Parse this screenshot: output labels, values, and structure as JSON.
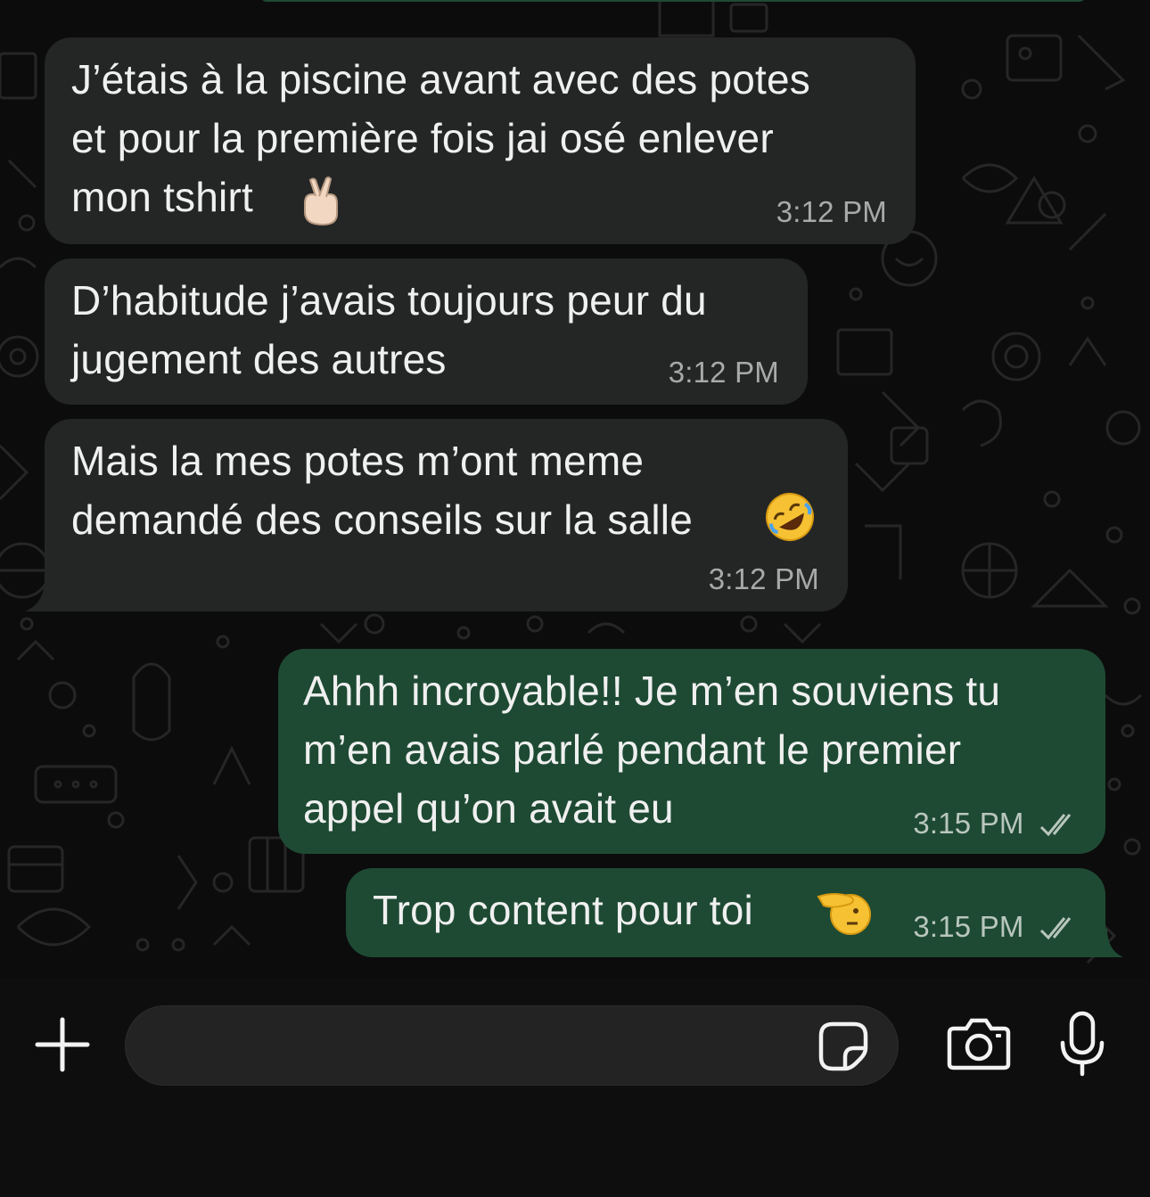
{
  "colors": {
    "background": "#0c0c0c",
    "incoming_bubble": "#242626",
    "outgoing_bubble": "#1e4a33",
    "text": "#f0f0f0",
    "timestamp": "#a7aaa8",
    "read_ticks": "#b9c6bd"
  },
  "messages": [
    {
      "direction": "incoming",
      "lines": [
        "J’étais à la piscine avant avec des potes",
        "et pour la première fois jai osé enlever",
        "mon tshirt"
      ],
      "emoji": "crossed-fingers",
      "time": "3:12 PM"
    },
    {
      "direction": "incoming",
      "lines": [
        "D’habitude j’avais toujours peur du",
        "jugement des autres"
      ],
      "time": "3:12 PM"
    },
    {
      "direction": "incoming",
      "lines": [
        "Mais la mes potes m’ont meme",
        "demandé des conseils sur la salle"
      ],
      "emoji": "rolling-on-floor-laughing",
      "time": "3:12 PM"
    },
    {
      "direction": "outgoing",
      "lines": [
        "Ahhh incroyable!! Je m’en souviens tu",
        "m’en avais parlé pendant le premier",
        "appel qu’on avait eu"
      ],
      "time": "3:15 PM",
      "status": "read"
    },
    {
      "direction": "outgoing",
      "lines": [
        "Trop content pour toi"
      ],
      "emoji": "saluting-face",
      "time": "3:15 PM",
      "status": "read"
    }
  ],
  "composer": {
    "input_value": "",
    "icons": [
      "plus-icon",
      "sticker-icon",
      "camera-icon",
      "microphone-icon"
    ]
  }
}
